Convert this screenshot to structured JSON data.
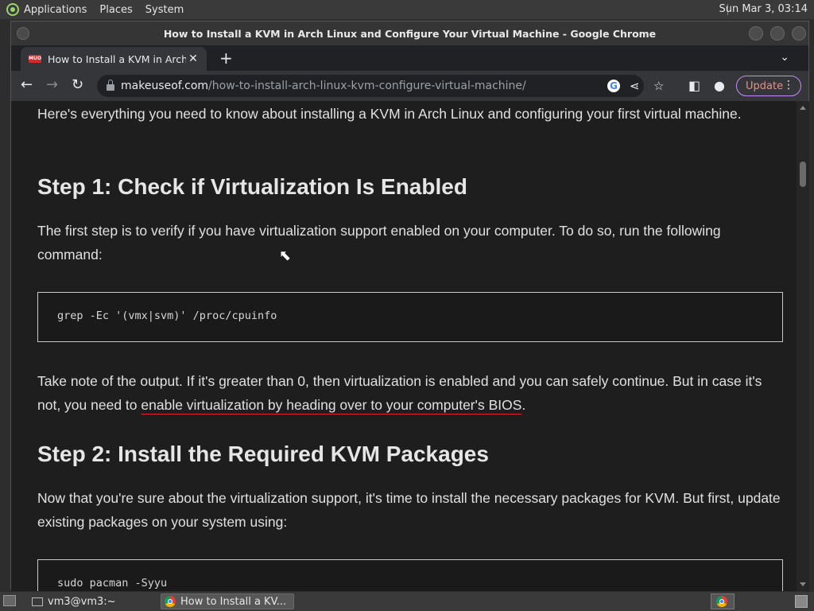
{
  "top_panel": {
    "menus": [
      "Applications",
      "Places",
      "System"
    ],
    "clock": "Sun Mar  3, 03:14"
  },
  "window": {
    "title": "How to Install a KVM in Arch Linux and Configure Your Virtual Machine - Google Chrome"
  },
  "tabs": [
    {
      "title": "How to Install a KVM in Arch Lin",
      "favicon": "MUO"
    }
  ],
  "address_bar": {
    "host": "makeuseof.com",
    "path": "/how-to-install-arch-linux-kvm-configure-virtual-machine/"
  },
  "toolbar": {
    "update_label": "Update"
  },
  "article": {
    "intro": "Here's everything you need to know about installing a KVM in Arch Linux and configuring your first virtual machine.",
    "step1_heading": "Step 1: Check if Virtualization Is Enabled",
    "step1_text": "The first step is to verify if you have virtualization support enabled on your computer. To do so, run the following command:",
    "step1_code": "grep -Ec '(vmx|svm)' /proc/cpuinfo",
    "step1_note_before": "Take note of the output. If it's greater than 0, then virtualization is enabled and you can safely continue. But in case it's not, you need to ",
    "step1_note_link": "enable virtualization by heading over to your computer's BIOS",
    "step1_note_after": ".",
    "step2_heading": "Step 2: Install the Required KVM Packages",
    "step2_text": "Now that you're sure about the virtualization support, it's time to install the necessary packages for KVM. But first, update existing packages on your system using:",
    "step2_code": "sudo pacman -Syyu"
  },
  "taskbar": {
    "tasks": [
      {
        "label": "vm3@vm3:~",
        "icon": "terminal-icon",
        "active": false
      },
      {
        "label": "How to Install a KV...",
        "icon": "chrome-icon",
        "active": true
      }
    ]
  }
}
